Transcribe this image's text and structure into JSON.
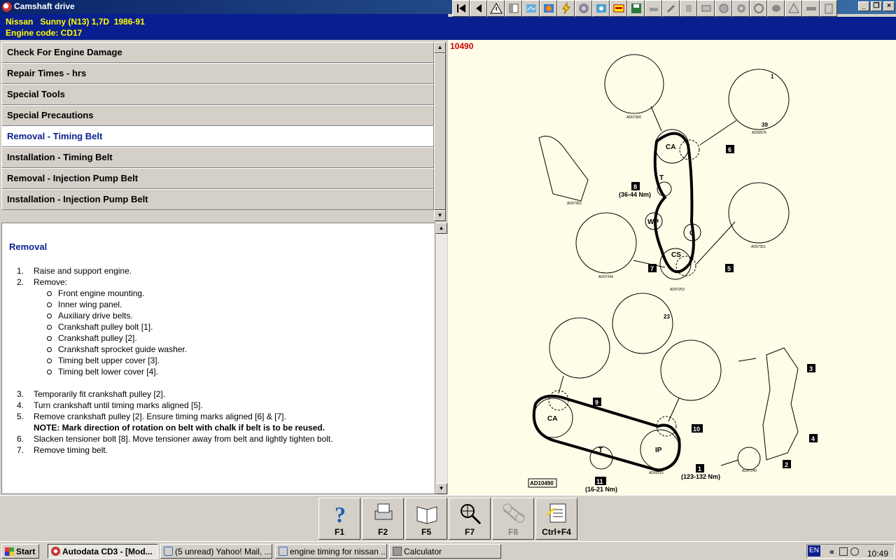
{
  "window": {
    "title": "Camshaft drive"
  },
  "vehicle": {
    "model_line": "Nissan   Sunny (N13) 1,7D  1986-91",
    "engine_line": "Engine code: CD17"
  },
  "menu": {
    "items": [
      {
        "label": "Check For Engine Damage"
      },
      {
        "label": "Repair Times - hrs"
      },
      {
        "label": "Special Tools"
      },
      {
        "label": "Special Precautions"
      },
      {
        "label": "Removal - Timing Belt",
        "selected": true
      },
      {
        "label": "Installation - Timing Belt"
      },
      {
        "label": "Removal - Injection Pump Belt"
      },
      {
        "label": "Installation - Injection Pump Belt"
      }
    ]
  },
  "content": {
    "section_title": "Removal",
    "steps": [
      {
        "n": "1.",
        "text": "Raise and support engine."
      },
      {
        "n": "2.",
        "text": "Remove:"
      },
      {
        "n": "3.",
        "text": "Temporarily fit crankshaft pulley [2]."
      },
      {
        "n": "4.",
        "text": "Turn crankshaft until timing marks aligned [5]."
      },
      {
        "n": "5.",
        "text": "Remove crankshaft pulley [2]. Ensure timing marks aligned [6] & [7]."
      },
      {
        "n": "6.",
        "text": "Slacken tensioner bolt [8]. Move tensioner away from belt and lightly tighten bolt."
      },
      {
        "n": "7.",
        "text": "Remove timing belt."
      }
    ],
    "remove_items": [
      "Front engine mounting.",
      "Inner wing panel.",
      "Auxiliary drive belts.",
      "Crankshaft pulley bolt [1].",
      "Crankshaft pulley [2].",
      "Crankshaft sprocket guide washer.",
      "Timing belt upper cover [3].",
      "Timing belt lower cover [4]."
    ],
    "note": "NOTE: Mark direction of rotation on belt with chalk if belt is to be reused."
  },
  "diagram": {
    "figure_id": "10490",
    "labels": {
      "ca_top": "CA",
      "wp": "WP",
      "g": "G",
      "cs": "CS",
      "t_top": "T",
      "torque8": "(36-44 Nm)",
      "ca_bottom": "CA",
      "ip": "IP",
      "t_bottom": "T",
      "torque11": "(16-21 Nm)",
      "torque1": "(123-132 Nm)",
      "ad_ref": "AD10490",
      "n1": "1",
      "n2": "2",
      "n3": "3",
      "n4": "4",
      "n5": "5",
      "n6": "6",
      "n7": "7",
      "n8": "8",
      "n9": "9",
      "n10": "10",
      "n11": "11",
      "tooth1": "1",
      "tooth39": "39",
      "tooth23": "23",
      "ad1": "AD07360",
      "ad2": "AD02676",
      "ad3": "AD07352",
      "ad4": "AD07351",
      "ad5": "AD07249",
      "ad6": "AD07253",
      "ad7": "AD07240",
      "ad8": "AD05215"
    }
  },
  "fkeys": [
    {
      "label": "F1",
      "icon": "help-icon"
    },
    {
      "label": "F2",
      "icon": "print-icon"
    },
    {
      "label": "F5",
      "icon": "book-icon"
    },
    {
      "label": "F7",
      "icon": "magnifier-icon"
    },
    {
      "label": "F8",
      "icon": "belt-icon",
      "disabled": true
    },
    {
      "label": "Ctrl+F4",
      "icon": "notes-icon"
    }
  ],
  "taskbar": {
    "start": "Start",
    "tasks": [
      {
        "label": "Autodata CD3 - [Mod...",
        "active": true
      },
      {
        "label": "(5 unread) Yahoo! Mail, ..."
      },
      {
        "label": "engine timing for nissan ..."
      },
      {
        "label": "Calculator"
      }
    ],
    "lang": "EN",
    "tray_chevron": "«",
    "clock": "10:49"
  }
}
